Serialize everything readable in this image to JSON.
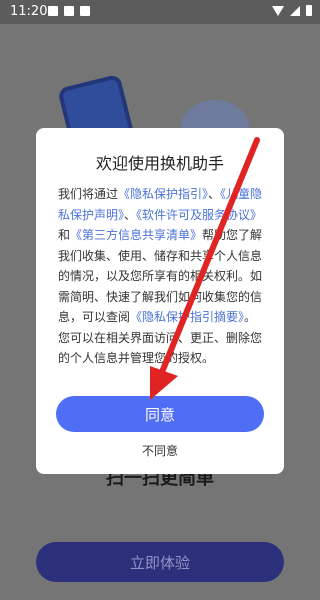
{
  "status_bar": {
    "time": "11:20",
    "icons": [
      "image-icon",
      "image-icon",
      "font-icon"
    ],
    "right_icons": [
      "wifi-icon",
      "signal-icon",
      "battery-icon"
    ]
  },
  "background": {
    "slogan": "扫一扫更简单",
    "start_button": "立即体验"
  },
  "dialog": {
    "title": "欢迎使用换机助手",
    "body_parts": [
      {
        "text": "我们将通过",
        "link": false
      },
      {
        "text": "《隐私保护指引》",
        "link": true
      },
      {
        "text": "、",
        "link": false
      },
      {
        "text": "《儿童隐私保护声明》",
        "link": true
      },
      {
        "text": "、",
        "link": false
      },
      {
        "text": "《软件许可及服务协议》",
        "link": true
      },
      {
        "text": "和",
        "link": false
      },
      {
        "text": "《第三方信息共享清单》",
        "link": true
      },
      {
        "text": "帮助您了解我们收集、使用、储存和共享个人信息的情况，以及您所享有的相关权利。如需简明、快速了解我们如何收集您的信息，可以查阅",
        "link": false
      },
      {
        "text": "《隐私保护指引摘要》",
        "link": true
      },
      {
        "text": "。",
        "link": false
      },
      {
        "text": "\n您可以在相关界面访问、更正、删除您的个人信息并管理您的授权。",
        "link": false
      }
    ],
    "agree_button": "同意",
    "disagree_button": "不同意"
  },
  "colors": {
    "accent": "#4f6df5",
    "link": "#4a72d8",
    "annotation_arrow": "#e02424"
  }
}
